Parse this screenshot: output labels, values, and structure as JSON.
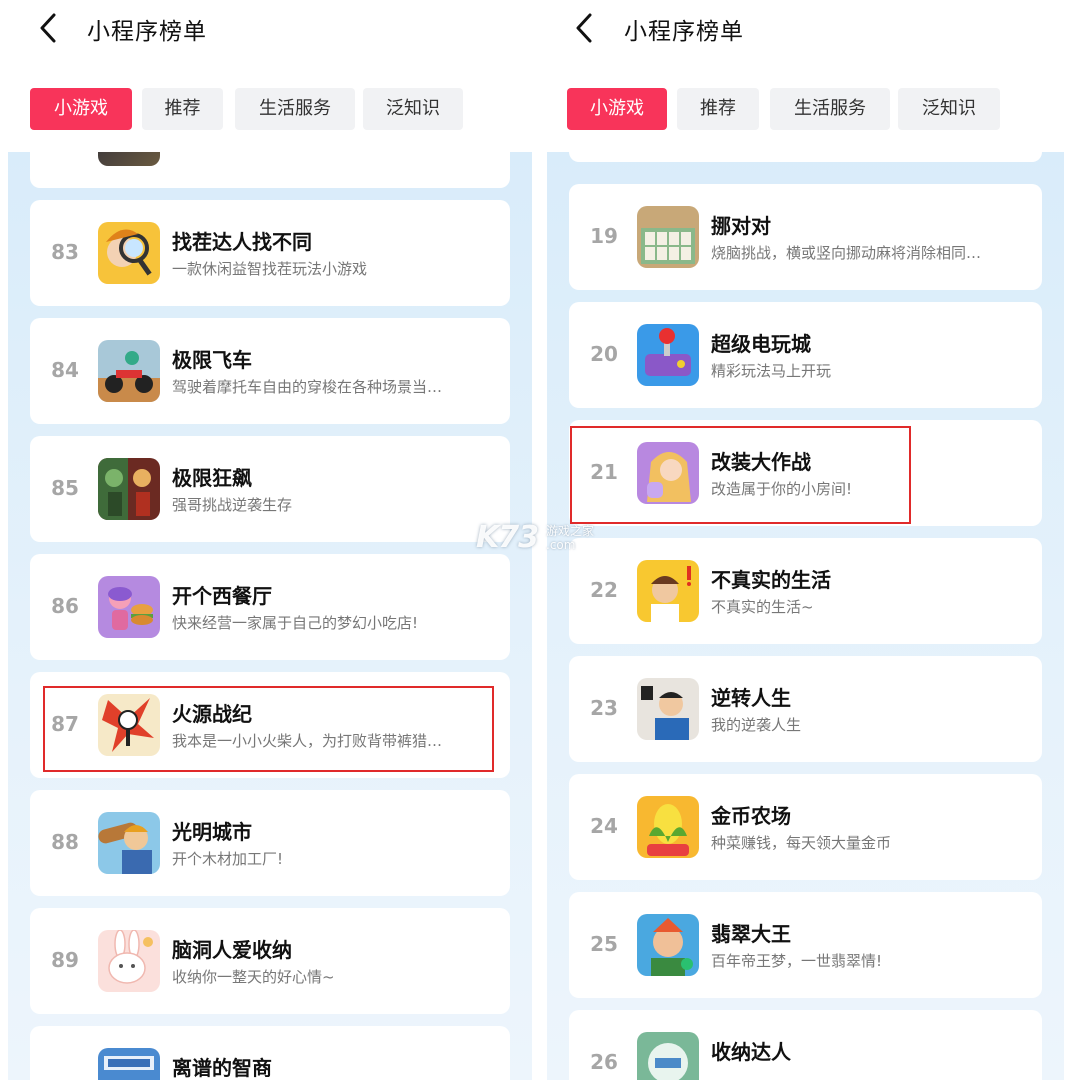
{
  "left": {
    "header": {
      "title": "小程序榜单"
    },
    "tabs": [
      {
        "label": "小游戏",
        "active": true
      },
      {
        "label": "推荐",
        "active": false
      },
      {
        "label": "生活服务",
        "active": false
      },
      {
        "label": "泛知识",
        "active": false
      }
    ],
    "items": [
      {
        "rank": "",
        "name": "",
        "desc": "",
        "icon": "app-icon-partial"
      },
      {
        "rank": "83",
        "name": "找茬达人找不同",
        "desc": "一款休闲益智找茬玩法小游戏",
        "icon": "magnifier-girl-icon"
      },
      {
        "rank": "84",
        "name": "极限飞车",
        "desc": "驾驶着摩托车自由的穿梭在各种场景当…",
        "icon": "motorbike-icon"
      },
      {
        "rank": "85",
        "name": "极限狂飙",
        "desc": "强哥挑战逆袭生存",
        "icon": "brawl-icon"
      },
      {
        "rank": "86",
        "name": "开个西餐厅",
        "desc": "快来经营一家属于自己的梦幻小吃店!",
        "icon": "burger-icon"
      },
      {
        "rank": "87",
        "name": "火源战纪",
        "desc": "我本是一小小火柴人，为打败背带裤猎…",
        "icon": "stickman-icon"
      },
      {
        "rank": "88",
        "name": "光明城市",
        "desc": "开个木材加工厂!",
        "icon": "lumberjack-icon"
      },
      {
        "rank": "89",
        "name": "脑洞人爱收纳",
        "desc": "收纳你一整天的好心情~",
        "icon": "bunny-icon"
      },
      {
        "rank": "",
        "name": "离谱的智商",
        "desc": "",
        "icon": "iq-game-icon"
      }
    ]
  },
  "right": {
    "header": {
      "title": "小程序榜单"
    },
    "tabs": [
      {
        "label": "小游戏",
        "active": true
      },
      {
        "label": "推荐",
        "active": false
      },
      {
        "label": "生活服务",
        "active": false
      },
      {
        "label": "泛知识",
        "active": false
      }
    ],
    "items": [
      {
        "rank": "",
        "name": "",
        "desc": "",
        "icon": ""
      },
      {
        "rank": "19",
        "name": "挪对对",
        "desc": "烧脑挑战，横或竖向挪动麻将消除相同…",
        "icon": "mahjong-icon"
      },
      {
        "rank": "20",
        "name": "超级电玩城",
        "desc": "精彩玩法马上开玩",
        "icon": "joystick-icon"
      },
      {
        "rank": "21",
        "name": "改装大作战",
        "desc": "改造属于你的小房间!",
        "icon": "princess-icon"
      },
      {
        "rank": "22",
        "name": "不真实的生活",
        "desc": "不真实的生活~",
        "icon": "chef-boy-icon"
      },
      {
        "rank": "23",
        "name": "逆转人生",
        "desc": "我的逆袭人生",
        "icon": "man-portrait-icon"
      },
      {
        "rank": "24",
        "name": "金币农场",
        "desc": "种菜赚钱，每天领大量金币",
        "icon": "corn-icon"
      },
      {
        "rank": "25",
        "name": "翡翠大王",
        "desc": "百年帝王梦，一世翡翠情!",
        "icon": "jade-king-icon"
      },
      {
        "rank": "26",
        "name": "收纳达人",
        "desc": "",
        "icon": "storage-icon"
      }
    ]
  },
  "watermark": {
    "main": "K73",
    "sub1": "游戏之家",
    "sub2": ".com"
  },
  "colors": {
    "accent": "#f8345a",
    "highlight": "#e02a2a",
    "list_bg": "#dcedfa"
  }
}
